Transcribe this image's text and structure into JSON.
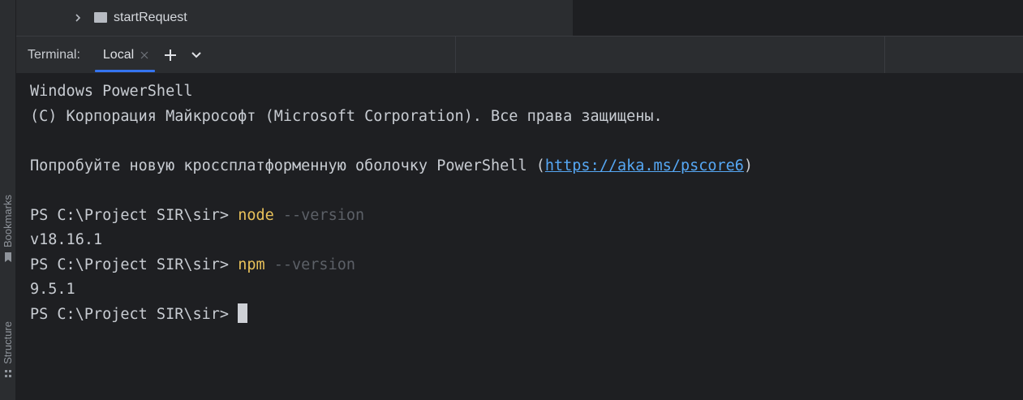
{
  "project_tree": {
    "folder_label": "startRequest"
  },
  "left_strip": {
    "bookmarks_label": "Bookmarks",
    "structure_label": "Structure"
  },
  "terminal_toolbar": {
    "title": "Terminal:",
    "tabs": [
      {
        "label": "Local",
        "active": true
      }
    ]
  },
  "terminal": {
    "lines": [
      {
        "text": "Windows PowerShell"
      },
      {
        "text": "(C) Корпорация Майкрософт (Microsoft Corporation). Все права защищены."
      },
      {
        "text": ""
      },
      {
        "prefix": "Попробуйте новую кроссплатформенную оболочку PowerShell (",
        "link": "https://aka.ms/pscore6",
        "suffix": ")"
      },
      {
        "text": ""
      },
      {
        "prompt": "PS C:\\Project SIR\\sir> ",
        "command": "node",
        "args": " --version"
      },
      {
        "text": "v18.16.1"
      },
      {
        "prompt": "PS C:\\Project SIR\\sir> ",
        "command": "npm",
        "args": " --version"
      },
      {
        "text": "9.5.1"
      },
      {
        "prompt": "PS C:\\Project SIR\\sir> "
      }
    ]
  },
  "colors": {
    "background": "#1e1f22",
    "panel": "#2b2d30",
    "text": "#c8ccd2",
    "command": "#e8c15a",
    "argument": "#5c6067",
    "link": "#56a8f5",
    "accent": "#3574f0"
  }
}
